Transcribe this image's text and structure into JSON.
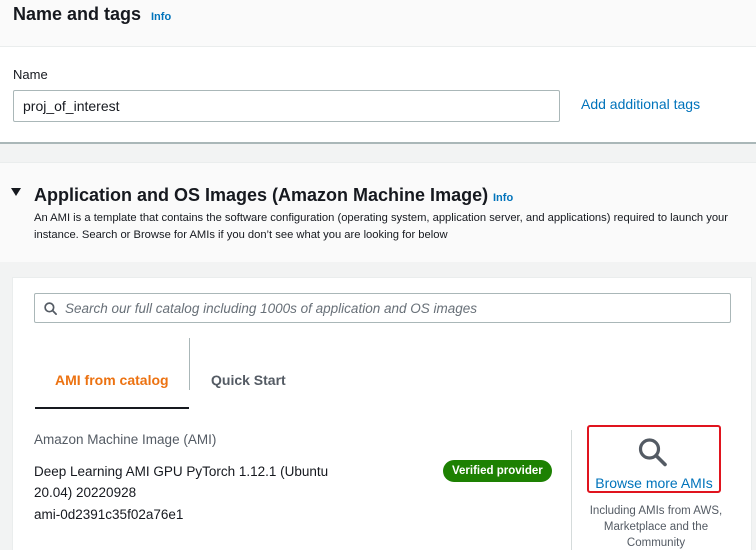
{
  "name_tags": {
    "title": "Name and tags",
    "info": "Info",
    "name_label": "Name",
    "name_value": "proj_of_interest",
    "add_tags": "Add additional tags"
  },
  "ami_section": {
    "title": "Application and OS Images (Amazon Machine Image)",
    "info": "Info",
    "description": "An AMI is a template that contains the software configuration (operating system, application server, and applications) required to launch your instance. Search or Browse for AMIs if you don’t see what you are looking for below",
    "search_placeholder": "Search our full catalog including 1000s of application and OS images",
    "tabs": [
      {
        "label": "AMI from catalog",
        "active": true
      },
      {
        "label": "Quick Start",
        "active": false
      }
    ],
    "ami_label": "Amazon Machine Image (AMI)",
    "ami_name": "Deep Learning AMI GPU PyTorch 1.12.1 (Ubuntu 20.04) 20220928",
    "ami_id": "ami-0d2391c35f02a76e1",
    "badge": "Verified provider",
    "browse_label": "Browse more AMIs",
    "browse_caption": "Including AMIs from AWS, Marketplace and the Community",
    "icons": {
      "search": "search-icon",
      "browse": "magnifier-icon",
      "collapse": "caret-down-icon"
    }
  },
  "colors": {
    "link": "#0073bb",
    "active_tab": "#ec7211",
    "badge": "#1d8102",
    "highlight_border": "#e0141e"
  }
}
